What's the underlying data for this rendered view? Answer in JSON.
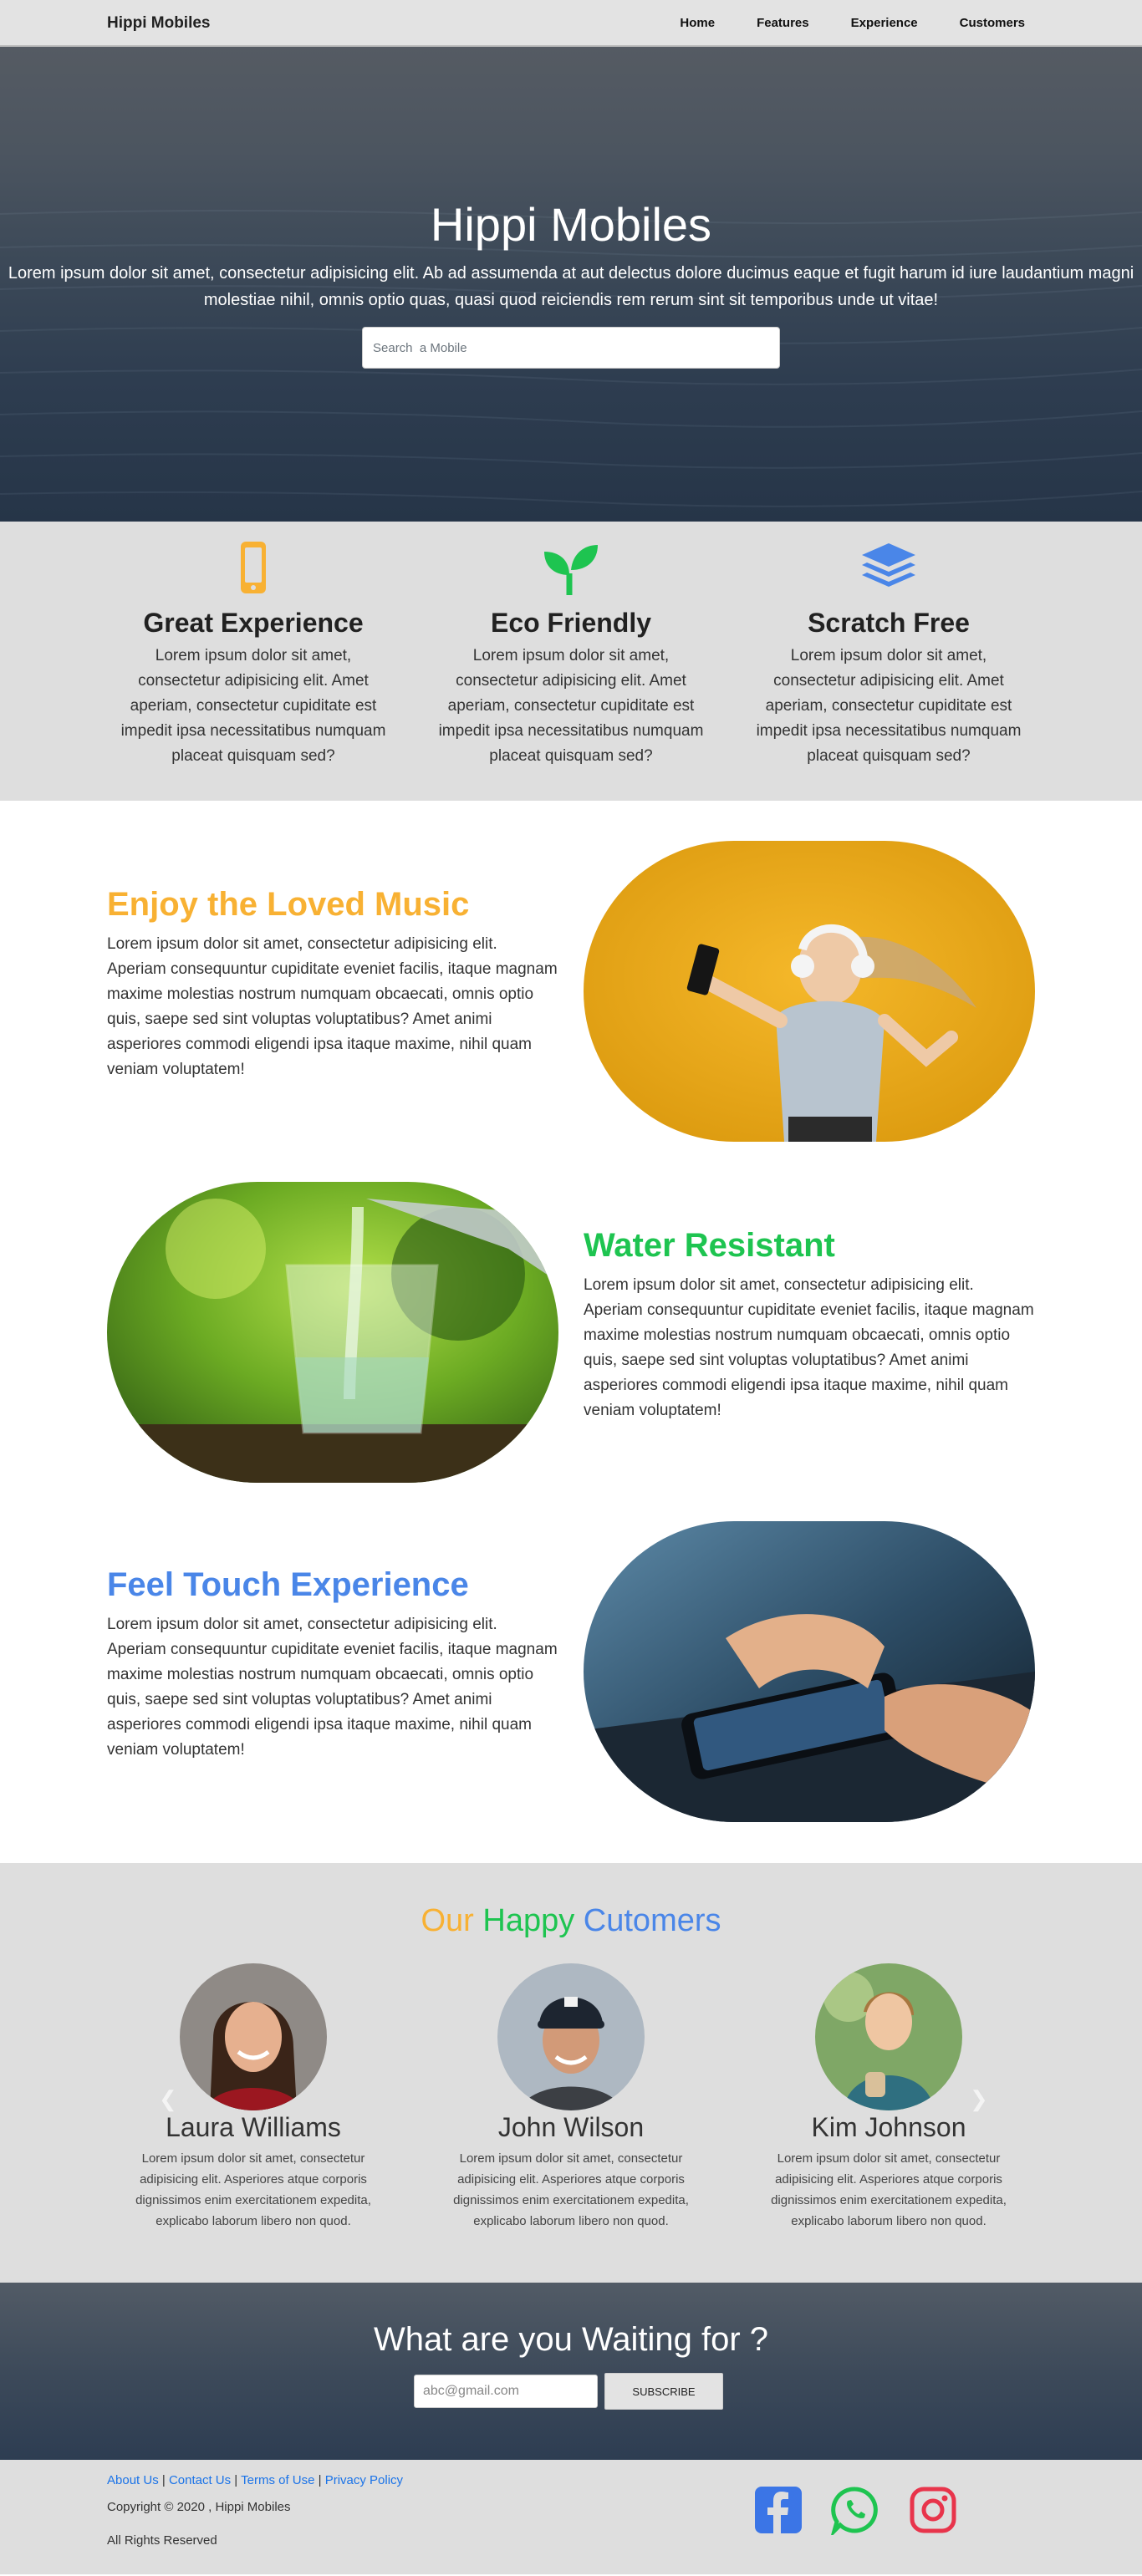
{
  "nav": {
    "brand": "Hippi Mobiles",
    "links": [
      "Home",
      "Features",
      "Experience",
      "Customers"
    ]
  },
  "hero": {
    "title": "Hippi Mobiles",
    "text": "Lorem ipsum dolor sit amet, consectetur adipisicing elit. Ab ad assumenda at aut delectus dolore ducimus eaque et fugit harum id iure laudantium magni molestiae nihil, omnis optio quas, quasi quod reiciendis rem rerum sint sit temporibus unde ut vitae!",
    "search_placeholder": "Search  a Mobile"
  },
  "features": [
    {
      "icon": "mobile-icon",
      "color": "#f8b133",
      "title": "Great Experience",
      "text": "Lorem ipsum dolor sit amet, consectetur adipisicing elit. Amet aperiam, consectetur cupiditate est impedit ipsa necessitatibus numquam placeat quisquam sed?"
    },
    {
      "icon": "seedling-icon",
      "color": "#1ec450",
      "title": "Eco Friendly",
      "text": "Lorem ipsum dolor sit amet, consectetur adipisicing elit. Amet aperiam, consectetur cupiditate est impedit ipsa necessitatibus numquam placeat quisquam sed?"
    },
    {
      "icon": "layers-icon",
      "color": "#4a86e8",
      "title": "Scratch Free",
      "text": "Lorem ipsum dolor sit amet, consectetur adipisicing elit. Amet aperiam, consectetur cupiditate est impedit ipsa necessitatibus numquam placeat quisquam sed?"
    }
  ],
  "showcase": [
    {
      "title": "Enjoy the Loved Music",
      "color": "#f8b133",
      "image": "woman-with-headphones-photo",
      "text": "Lorem ipsum dolor sit amet, consectetur adipisicing elit. Aperiam consequuntur cupiditate eveniet facilis, itaque magnam maxime molestias nostrum numquam obcaecati, omnis optio quis, saepe sed sint voluptas voluptatibus? Amet animi asperiores commodi eligendi ipsa itaque maxime, nihil quam veniam voluptatem!"
    },
    {
      "title": "Water Resistant",
      "color": "#1ec450",
      "image": "glass-of-water-photo",
      "text": "Lorem ipsum dolor sit amet, consectetur adipisicing elit. Aperiam consequuntur cupiditate eveniet facilis, itaque magnam maxime molestias nostrum numquam obcaecati, omnis optio quis, saepe sed sint voluptas voluptatibus? Amet animi asperiores commodi eligendi ipsa itaque maxime, nihil quam veniam voluptatem!"
    },
    {
      "title": "Feel Touch Experience",
      "color": "#4a86e8",
      "image": "hand-on-phone-photo",
      "text": "Lorem ipsum dolor sit amet, consectetur adipisicing elit. Aperiam consequuntur cupiditate eveniet facilis, itaque magnam maxime molestias nostrum numquam obcaecati, omnis optio quis, saepe sed sint voluptas voluptatibus? Amet animi asperiores commodi eligendi ipsa itaque maxime, nihil quam veniam voluptatem!"
    }
  ],
  "customers": {
    "title_parts": [
      {
        "text": "Our",
        "color": "#f8b133"
      },
      {
        "text": "Happy",
        "color": "#1ec450"
      },
      {
        "text": "Cutomers",
        "color": "#4a86e8"
      }
    ],
    "items": [
      {
        "name": "Laura Williams",
        "text": "Lorem ipsum dolor sit amet, consectetur adipisicing elit. Asperiores atque corporis dignissimos enim exercitationem expedita, explicabo laborum libero non quod."
      },
      {
        "name": "John Wilson",
        "text": "Lorem ipsum dolor sit amet, consectetur adipisicing elit. Asperiores atque corporis dignissimos enim exercitationem expedita, explicabo laborum libero non quod."
      },
      {
        "name": "Kim Johnson",
        "text": "Lorem ipsum dolor sit amet, consectetur adipisicing elit. Asperiores atque corporis dignissimos enim exercitationem expedita, explicabo laborum libero non quod."
      }
    ],
    "prev_icon": "chevron-left-icon",
    "next_icon": "chevron-right-icon"
  },
  "cta": {
    "title": "What are you Waiting for ?",
    "email_placeholder": "abc@gmail.com",
    "button": "SUBSCRIBE"
  },
  "footer": {
    "links": [
      "About Us",
      "Contact Us",
      "Terms of Use",
      "Privacy Policy"
    ],
    "separator": " | ",
    "copyright": "Copyright © 2020 , Hippi Mobiles",
    "rights": "All Rights Reserved",
    "social": [
      {
        "icon": "facebook-icon",
        "color": "#3b75e6"
      },
      {
        "icon": "whatsapp-icon",
        "color": "#1ec450"
      },
      {
        "icon": "instagram-icon",
        "color": "#e8344b"
      }
    ]
  }
}
